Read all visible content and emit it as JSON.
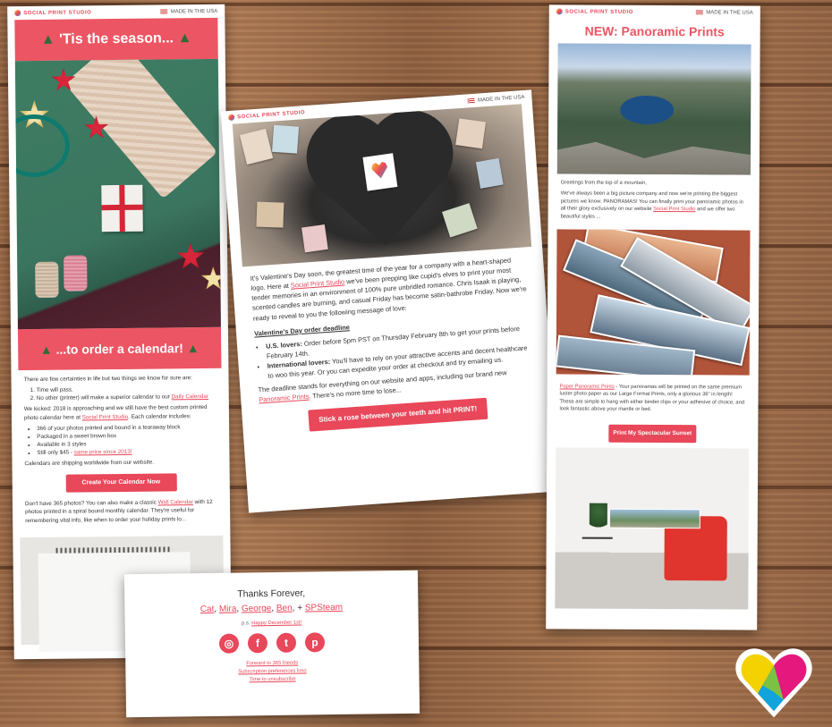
{
  "colors": {
    "brand_red": "#e9475a",
    "wood": "#9c6a48"
  },
  "brand": {
    "name": "SOCIAL PRINT STUDIO",
    "made": "MADE IN THE USA"
  },
  "card1": {
    "title": "'Tis the season...",
    "subtitle": "...to order a calendar!",
    "intro": "There are few certainties in life but two things we know for sure are:",
    "list": [
      "Time will pass.",
      "No other (printer) will make a superior calendar to our "
    ],
    "list_link": "Daily Calendar",
    "para2_a": "We kicked: 2018 is approaching and we still have the best custom printed photo calendar here at ",
    "para2_link": "Social Print Studio",
    "para2_b": ". Each calendar includes:",
    "features": [
      "366 of your photos printed and bound in a tearaway block",
      "Packaged in a sweet brown box",
      "Available in 3 styles",
      "Still only $45 - "
    ],
    "features_link": "same price since 2013!",
    "shipping": "Calendars are shipping worldwide from our website.",
    "cta": "Create Your Calendar Now",
    "extra_a": "Don't have 365 photos? You can also make a classic ",
    "extra_link": "Wall Calendar",
    "extra_b": " with 12 photos printed in a spiral bound monthly calendar. They're useful for remembering vital info, like when to order your holiday prints lo..."
  },
  "card2": {
    "p1_a": "It's Valentine's Day soon, the greatest time of the year for a company with a heart-shaped logo. Here at ",
    "p1_link": "Social Print Studio",
    "p1_b": " we've been prepping like cupid's elves to print your most tender memories in an environment of 100% pure unbridled romance. Chris Isaak is playing, scented candles are burning, and casual Friday has become satin-bathrobe Friday. Now we're ready to reveal to you the following message of love:",
    "heading": "Valentine's Day order deadline",
    "b1_label": "U.S. lovers:",
    "b1_text": " Order before 5pm PST on Thursday February 8th to get your prints before February 14th.",
    "b2_label": "International lovers:",
    "b2_text": " You'll have to rely on your attractive accents and decent healthcare to woo this year. Or you can expedite your order at checkout and try emailing us.",
    "p2_a": "The deadline stands for everything on our website and apps, including our brand new ",
    "p2_link": "Panoramic Prints",
    "p2_b": ". There's no more time to lose...",
    "cta": "Stick a rose between your teeth and hit PRINT!"
  },
  "card3": {
    "title": "NEW: Panoramic Prints",
    "greeting": "Greetings from the top of a mountain,",
    "p1_a": "We've always been a big picture company and now we're printing the biggest pictures we know: PANORAMAS! You can finally print your panoramic photos in all their glory exclusively on our website ",
    "p1_link": "Social Print Studio",
    "p1_b": " and we offer two beautiful styles ...",
    "p2_link": "Paper Panoramic Prints",
    "p2_text": " - Your panoramas will be printed on the same premium luster photo paper as our Large Format Prints, only a glorious 36\" in length! These are simple to hang with either binder clips or your adhesive of choice, and look fantastic above your mantle or bed.",
    "cta": "Print My Spectacular Sunset"
  },
  "card4": {
    "thanks": "Thanks Forever,",
    "names": [
      "Cat",
      "Mira",
      "George",
      "Ben"
    ],
    "team": "SPSteam",
    "ps_label": "p.s.",
    "ps_link": "Happy December 1st!",
    "social": [
      {
        "icon": "instagram-icon",
        "glyph": "◎"
      },
      {
        "icon": "facebook-icon",
        "glyph": "f"
      },
      {
        "icon": "twitter-icon",
        "glyph": "t"
      },
      {
        "icon": "pinterest-icon",
        "glyph": "p"
      }
    ],
    "links": [
      "Forward to 365 friends",
      "Subscription preferences limo",
      "Time to unsubscribe"
    ]
  }
}
